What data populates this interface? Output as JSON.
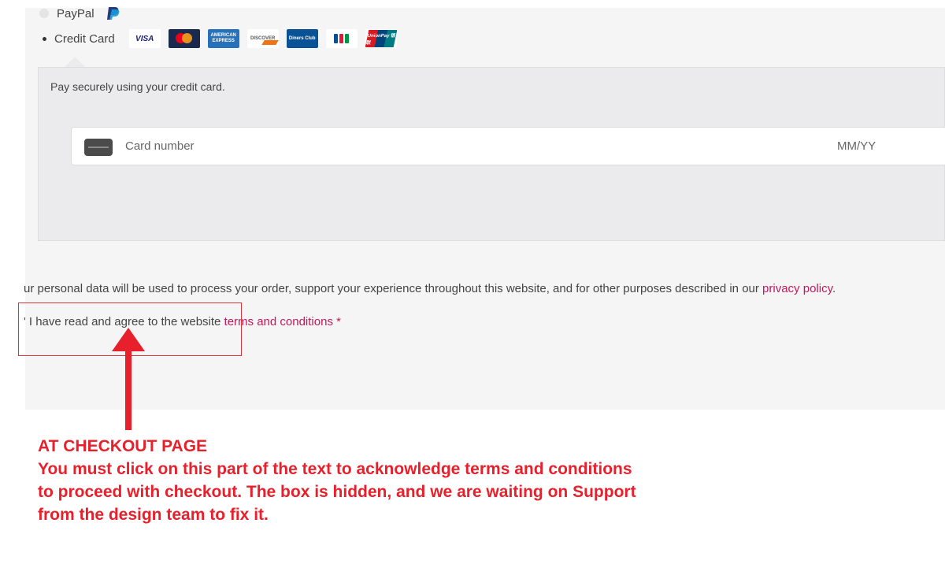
{
  "payment_methods": {
    "paypal": {
      "label": "PayPal",
      "icon": "paypal-icon"
    },
    "credit_card": {
      "label": "Credit Card",
      "logos": [
        {
          "name": "visa-logo",
          "text": "VISA"
        },
        {
          "name": "mastercard-logo"
        },
        {
          "name": "amex-logo",
          "text": "AMERICAN EXPRESS"
        },
        {
          "name": "discover-logo",
          "text": "DISCOVER"
        },
        {
          "name": "diners-club-logo",
          "text": "Diners Club"
        },
        {
          "name": "jcb-logo"
        },
        {
          "name": "unionpay-logo",
          "text": "UnionPay 银联"
        }
      ]
    }
  },
  "credit_card_box": {
    "description": "Pay securely using your credit card.",
    "card_number_placeholder": "Card number",
    "expiry_placeholder": "MM/YY"
  },
  "privacy": {
    "text": "ur personal data will be used to process your order, support your experience throughout this website, and for other purposes described in our ",
    "link": "privacy policy",
    "end": "."
  },
  "terms": {
    "prefix_mark": "'",
    "text": "I have read and agree to the website ",
    "link": "terms and conditions",
    "required": "*"
  },
  "annotation": {
    "line1": "AT  CHECKOUT PAGE",
    "line2": "You must click on this part of the text to acknowledge terms and conditions",
    "line3": "to proceed with checkout.  The box is hidden, and we are waiting on Support",
    "line4": "from the design team to fix it."
  },
  "colors": {
    "accent_link": "#c2185b",
    "annotation_red": "#e8202b",
    "panel_bg": "#f5f5f5",
    "cc_box_bg": "#ebebed"
  }
}
